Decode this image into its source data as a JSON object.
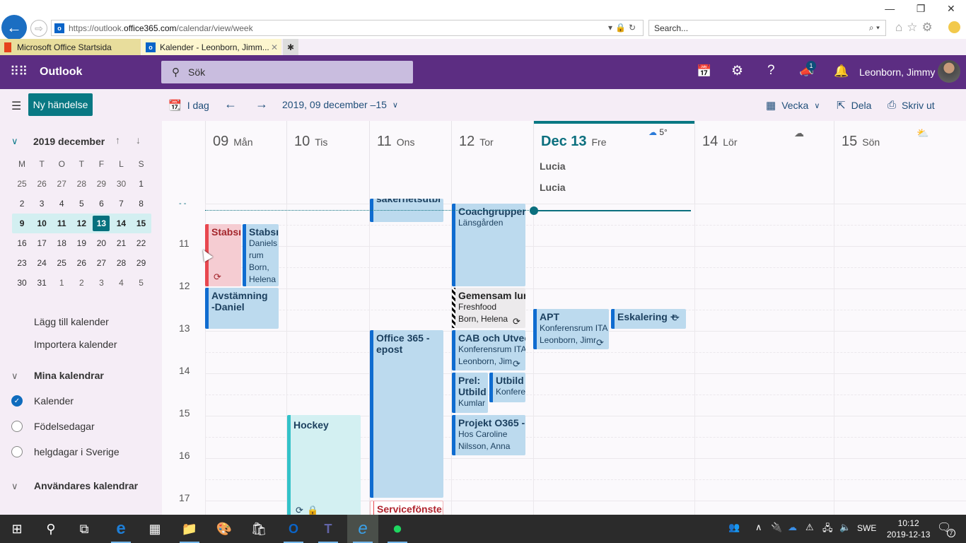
{
  "browser": {
    "url_prefix": "https://outlook.",
    "url_domain": "office365.com",
    "url_path": "/calendar/view/week",
    "search_placeholder": "Search...",
    "tabs": [
      {
        "label": "Microsoft Office Startsida"
      },
      {
        "label": "Kalender - Leonborn, Jimm...",
        "active": true
      }
    ],
    "window_controls": {
      "minimize": "—",
      "restore": "❐",
      "close": "✕"
    }
  },
  "header": {
    "app_name": "Outlook",
    "search_placeholder": "Sök",
    "notification_badge": "1",
    "user_name": "Leonborn, Jimmy",
    "icons": [
      "my-day-icon",
      "settings-icon",
      "help-icon",
      "feedback-icon",
      "bell-icon"
    ]
  },
  "commandbar": {
    "new_event": "Ny händelse",
    "today": "I dag",
    "date_range": "2019, 09 december –15",
    "view": "Vecka",
    "share": "Dela",
    "print": "Skriv ut"
  },
  "minicalendar": {
    "title": "2019 december",
    "weekday_headers": [
      "M",
      "T",
      "O",
      "T",
      "F",
      "L",
      "S"
    ],
    "weeks": [
      [
        "25",
        "26",
        "27",
        "28",
        "29",
        "30",
        "1"
      ],
      [
        "2",
        "3",
        "4",
        "5",
        "6",
        "7",
        "8"
      ],
      [
        "9",
        "10",
        "11",
        "12",
        "13",
        "14",
        "15"
      ],
      [
        "16",
        "17",
        "18",
        "19",
        "20",
        "21",
        "22"
      ],
      [
        "23",
        "24",
        "25",
        "26",
        "27",
        "28",
        "29"
      ],
      [
        "30",
        "31",
        "1",
        "2",
        "3",
        "4",
        "5"
      ]
    ],
    "selected_week_index": 2,
    "today": "13"
  },
  "leftpane": {
    "add_calendar": "Lägg till kalender",
    "import_calendar": "Importera kalender",
    "my_calendars": "Mina kalendrar",
    "calendars": [
      {
        "label": "Kalender",
        "checked": true
      },
      {
        "label": "Födelsedagar",
        "checked": false
      },
      {
        "label": "helgdagar i Sverige",
        "checked": false
      }
    ],
    "users_calendars": "Användares kalendrar"
  },
  "week": {
    "days": [
      {
        "num": "09",
        "name": "Mån"
      },
      {
        "num": "10",
        "name": "Tis"
      },
      {
        "num": "11",
        "name": "Ons"
      },
      {
        "num": "12",
        "name": "Tor"
      },
      {
        "num": "Dec 13",
        "name": "Fre",
        "today": true,
        "weather": "5°",
        "allday": [
          "Lucia",
          "Lucia"
        ]
      },
      {
        "num": "14",
        "name": "Lör",
        "weather": ""
      },
      {
        "num": "15",
        "name": "Sön",
        "weather": ""
      }
    ],
    "hours": [
      "11",
      "12",
      "13",
      "14",
      "15",
      "16",
      "17"
    ],
    "events": {
      "sakerhet": {
        "title": "säkerhetsutbi"
      },
      "coach": {
        "title": "Coachgrupper",
        "sub1": "Länsgården"
      },
      "stabs1": {
        "title": "Stabsı"
      },
      "stabs2": {
        "title": "Stabsı",
        "sub1": "Daniels",
        "sub2": "rum",
        "sub3": "Born,",
        "sub4": "Helena"
      },
      "avst": {
        "title": "Avstämning",
        "title2": "-Daniel"
      },
      "gemensam": {
        "title": "Gemensam lur",
        "sub1": "Freshfood",
        "sub2": "Born, Helena"
      },
      "apt": {
        "title": "APT",
        "sub1": "Konferensrum ITA",
        "sub2": "Leonborn, Jimr"
      },
      "eskalering": {
        "title": "Eskalering +"
      },
      "office365": {
        "title": "Office 365 -",
        "title2": "epost"
      },
      "cab": {
        "title": "CAB och Utvec",
        "sub1": "Konferensrum ITA",
        "sub2": "Leonborn, Jim"
      },
      "prel": {
        "title": "Prel:",
        "title2": "Utbild",
        "sub1": "Kumlar"
      },
      "utbild": {
        "title": "Utbild",
        "sub1": "Konfere"
      },
      "projekt": {
        "title": "Projekt O365 -",
        "sub1": "Hos Caroline",
        "sub2": "Nilsson, Anna"
      },
      "hockey": {
        "title": "Hockey"
      },
      "service": {
        "title": "Servicefönster"
      }
    }
  },
  "taskbar": {
    "language": "SWE",
    "time": "10:12",
    "date": "2019-12-13",
    "notifications": "7"
  }
}
